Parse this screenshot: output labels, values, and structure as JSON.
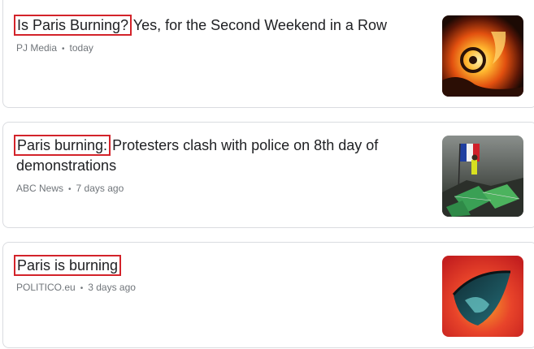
{
  "results": [
    {
      "highlight": "Is Paris Burning?",
      "rest": " Yes, for the Second Weekend in a Row",
      "source": "PJ Media",
      "time": "today",
      "thumb_icon": "burning-car-thumbnail"
    },
    {
      "highlight": "Paris burning:",
      "rest": " Protesters clash with police on 8th day of demonstrations",
      "source": "ABC News",
      "time": "7 days ago",
      "thumb_icon": "protest-barricade-thumbnail"
    },
    {
      "highlight": "Paris is burning",
      "rest": "",
      "source": "POLITICO.eu",
      "time": "3 days ago",
      "thumb_icon": "burning-globe-thumbnail"
    }
  ],
  "separator": "•",
  "colors": {
    "highlight_box": "#d3232a",
    "headline": "#202124",
    "meta": "#70757a",
    "card_border": "#dadce0"
  }
}
